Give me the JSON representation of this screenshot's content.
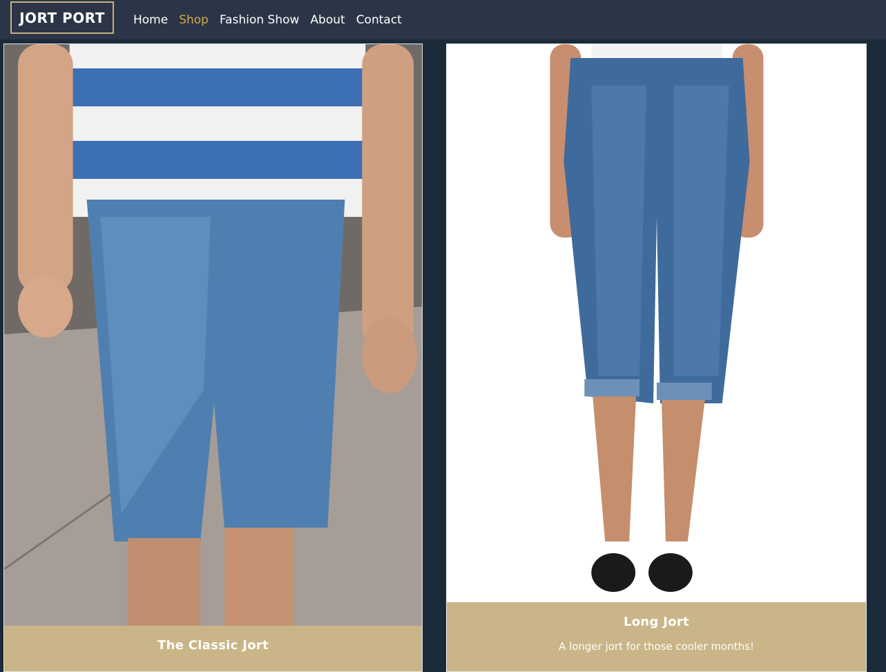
{
  "brand": {
    "label": "JORT PORT",
    "border_color": "#c9b27d"
  },
  "nav": {
    "items": [
      {
        "label": "Home",
        "active": false
      },
      {
        "label": "Shop",
        "active": true
      },
      {
        "label": "Fashion Show",
        "active": false
      },
      {
        "label": "About",
        "active": false
      },
      {
        "label": "Contact",
        "active": false
      }
    ],
    "active_color": "#d4a84f"
  },
  "products": [
    {
      "title": "The Classic Jort",
      "description": "",
      "image": "man-in-striped-shirt-wearing-denim-jorts"
    },
    {
      "title": "Long Jort",
      "description": "A longer jort for those cooler months!",
      "image": "woman-wearing-cuffed-capri-jeans-and-black-sandals"
    }
  ],
  "colors": {
    "background": "#1c2b3a",
    "navbar": "#2b3547",
    "card_footer": "#c9b587"
  }
}
